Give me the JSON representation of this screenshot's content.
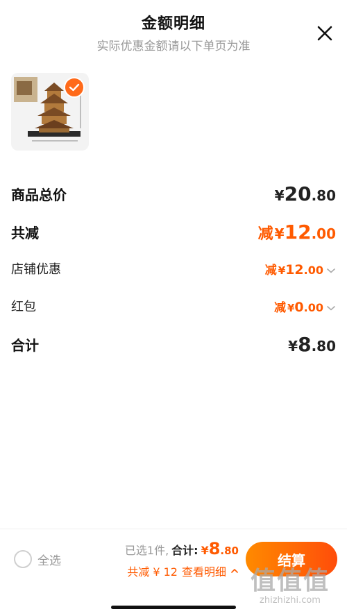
{
  "header": {
    "title": "金额明细",
    "subtitle": "实际优惠金额请以下单页为准"
  },
  "icons": {
    "close": "close-icon",
    "check": "check-icon",
    "chevron": "chevron-down-icon"
  },
  "colors": {
    "accent": "#ff5a00",
    "checkout_start": "#ff8a00",
    "checkout_end": "#ff4d0a"
  },
  "rows": {
    "goods_total": {
      "label": "商品总价",
      "yen": "¥",
      "int": "20",
      "dec": ".80"
    },
    "total_discount": {
      "label": "共减",
      "prefix": "减",
      "yen": "¥",
      "int": "12",
      "dec": ".00"
    },
    "store_discount": {
      "label": "店铺优惠",
      "prefix": "减",
      "yen": "¥",
      "int": "12",
      "dec": ".00"
    },
    "red_packet": {
      "label": "红包",
      "prefix": "减",
      "yen": "¥",
      "int": "0",
      "dec": ".00"
    },
    "grand_total": {
      "label": "合计",
      "yen": "¥",
      "int": "8",
      "dec": ".80"
    }
  },
  "bottom": {
    "select_all": "全选",
    "selected_count": "已选1件,",
    "total_label": "合计:",
    "total_yen": "¥",
    "total_int": "8",
    "total_dec": ".80",
    "discount_text": "共减 ¥ 12",
    "view_details": "查看明细",
    "checkout": "结算"
  },
  "watermark": {
    "logo": "值值值",
    "url": "zhizhizhi.com"
  }
}
